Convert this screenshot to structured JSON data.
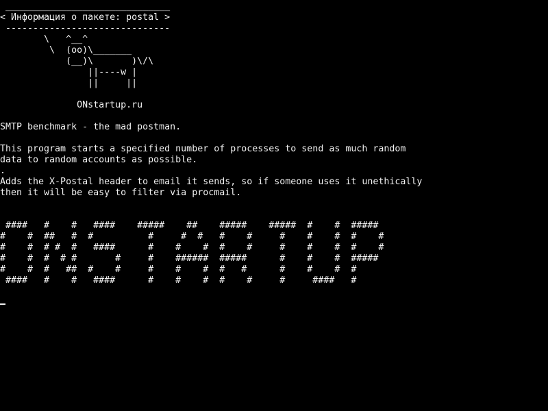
{
  "terminal": {
    "colors": {
      "background": "#000000",
      "foreground": "#f2f2f2"
    },
    "header": {
      "top_rule": " ______________________________",
      "title": "< Информация о пакете: postal >",
      "bottom_rule": " ------------------------------"
    },
    "cowsay": [
      "        \\   ^__^",
      "         \\  (oo)\\_______",
      "            (__)\\       )\\/\\",
      "                ||----w |",
      "                ||     ||"
    ],
    "site": "              ONstartup.ru",
    "summary": "SMTP benchmark - the mad postman.",
    "description": [
      "This program starts a specified number of processes to send as much random",
      "data to random accounts as possible.",
      ".",
      "Adds the X-Postal header to email it sends, so if someone uses it unethically",
      "then it will be easy to filter via procmail."
    ],
    "banner": [
      " ####   #    #   ####    #####    ##    #####    #####  #    #  #####",
      "#    #  ##   #  #          #     #  #   #    #     #    #    #  #    #",
      "#    #  # #  #   ####      #    #    #  #    #     #    #    #  #    #",
      "#    #  #  # #       #     #    ######  #####      #    #    #  #####",
      "#    #  #   ##  #    #     #    #    #  #   #      #    #    #  #",
      " ####   #    #   ####      #    #    #  #    #     #     ####   #"
    ]
  }
}
